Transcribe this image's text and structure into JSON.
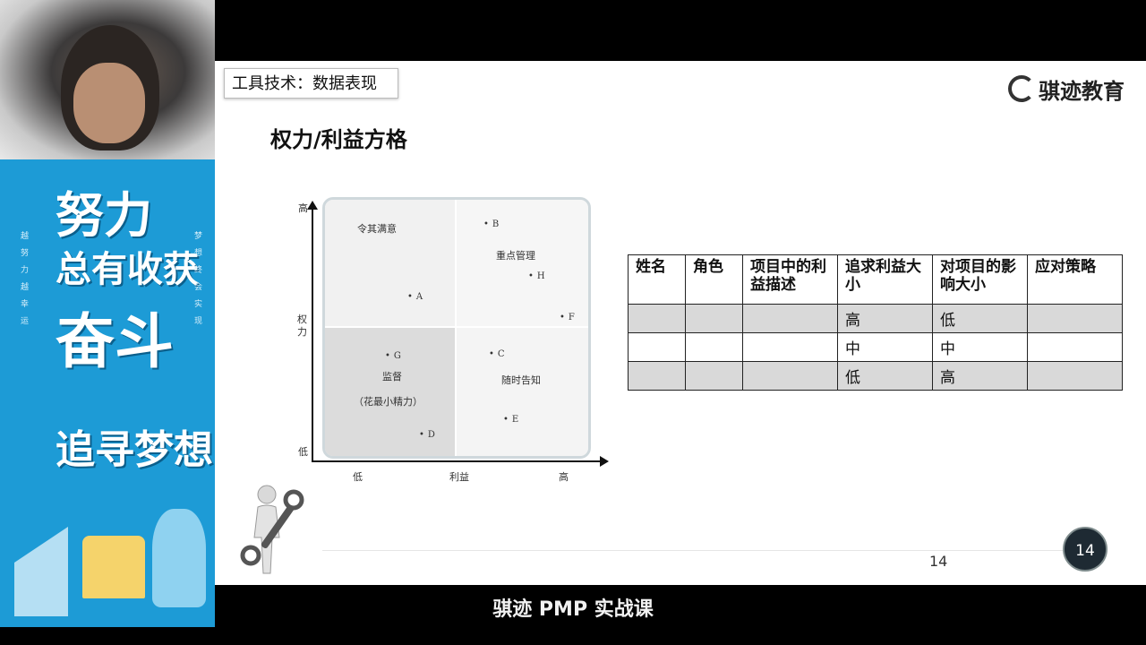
{
  "banner": {
    "line1": "努力",
    "line2": "总有收获",
    "line3": "奋斗",
    "line4": "追寻梦想",
    "side_left": "越努力越幸运",
    "side_right": "梦想终会实现"
  },
  "slide": {
    "tool_tag": "工具技术：数据表现",
    "logo_text": "骐迹教育",
    "title": "权力/利益方格",
    "page_number": "14",
    "badge_number": "14"
  },
  "grid": {
    "quadrant_labels": {
      "top_left": "令其满意",
      "top_right": "重点管理",
      "bottom_left": "监督",
      "bottom_left_sub": "（花最小精力）",
      "bottom_right": "随时告知"
    },
    "points": [
      "A",
      "B",
      "C",
      "D",
      "E",
      "F",
      "G",
      "H"
    ],
    "y_axis": {
      "high": "高",
      "label": "权力",
      "low": "低"
    },
    "x_axis": {
      "low": "低",
      "label": "利益",
      "high": "高"
    }
  },
  "table": {
    "headers": [
      "姓名",
      "角色",
      "项目中的利益描述",
      "追求利益大小",
      "对项目的影响大小",
      "应对策略"
    ],
    "rows": [
      [
        "",
        "",
        "",
        "高",
        "低",
        ""
      ],
      [
        "",
        "",
        "",
        "中",
        "中",
        ""
      ],
      [
        "",
        "",
        "",
        "低",
        "高",
        ""
      ]
    ]
  },
  "footer": {
    "caption": "骐迹 PMP 实战课"
  }
}
